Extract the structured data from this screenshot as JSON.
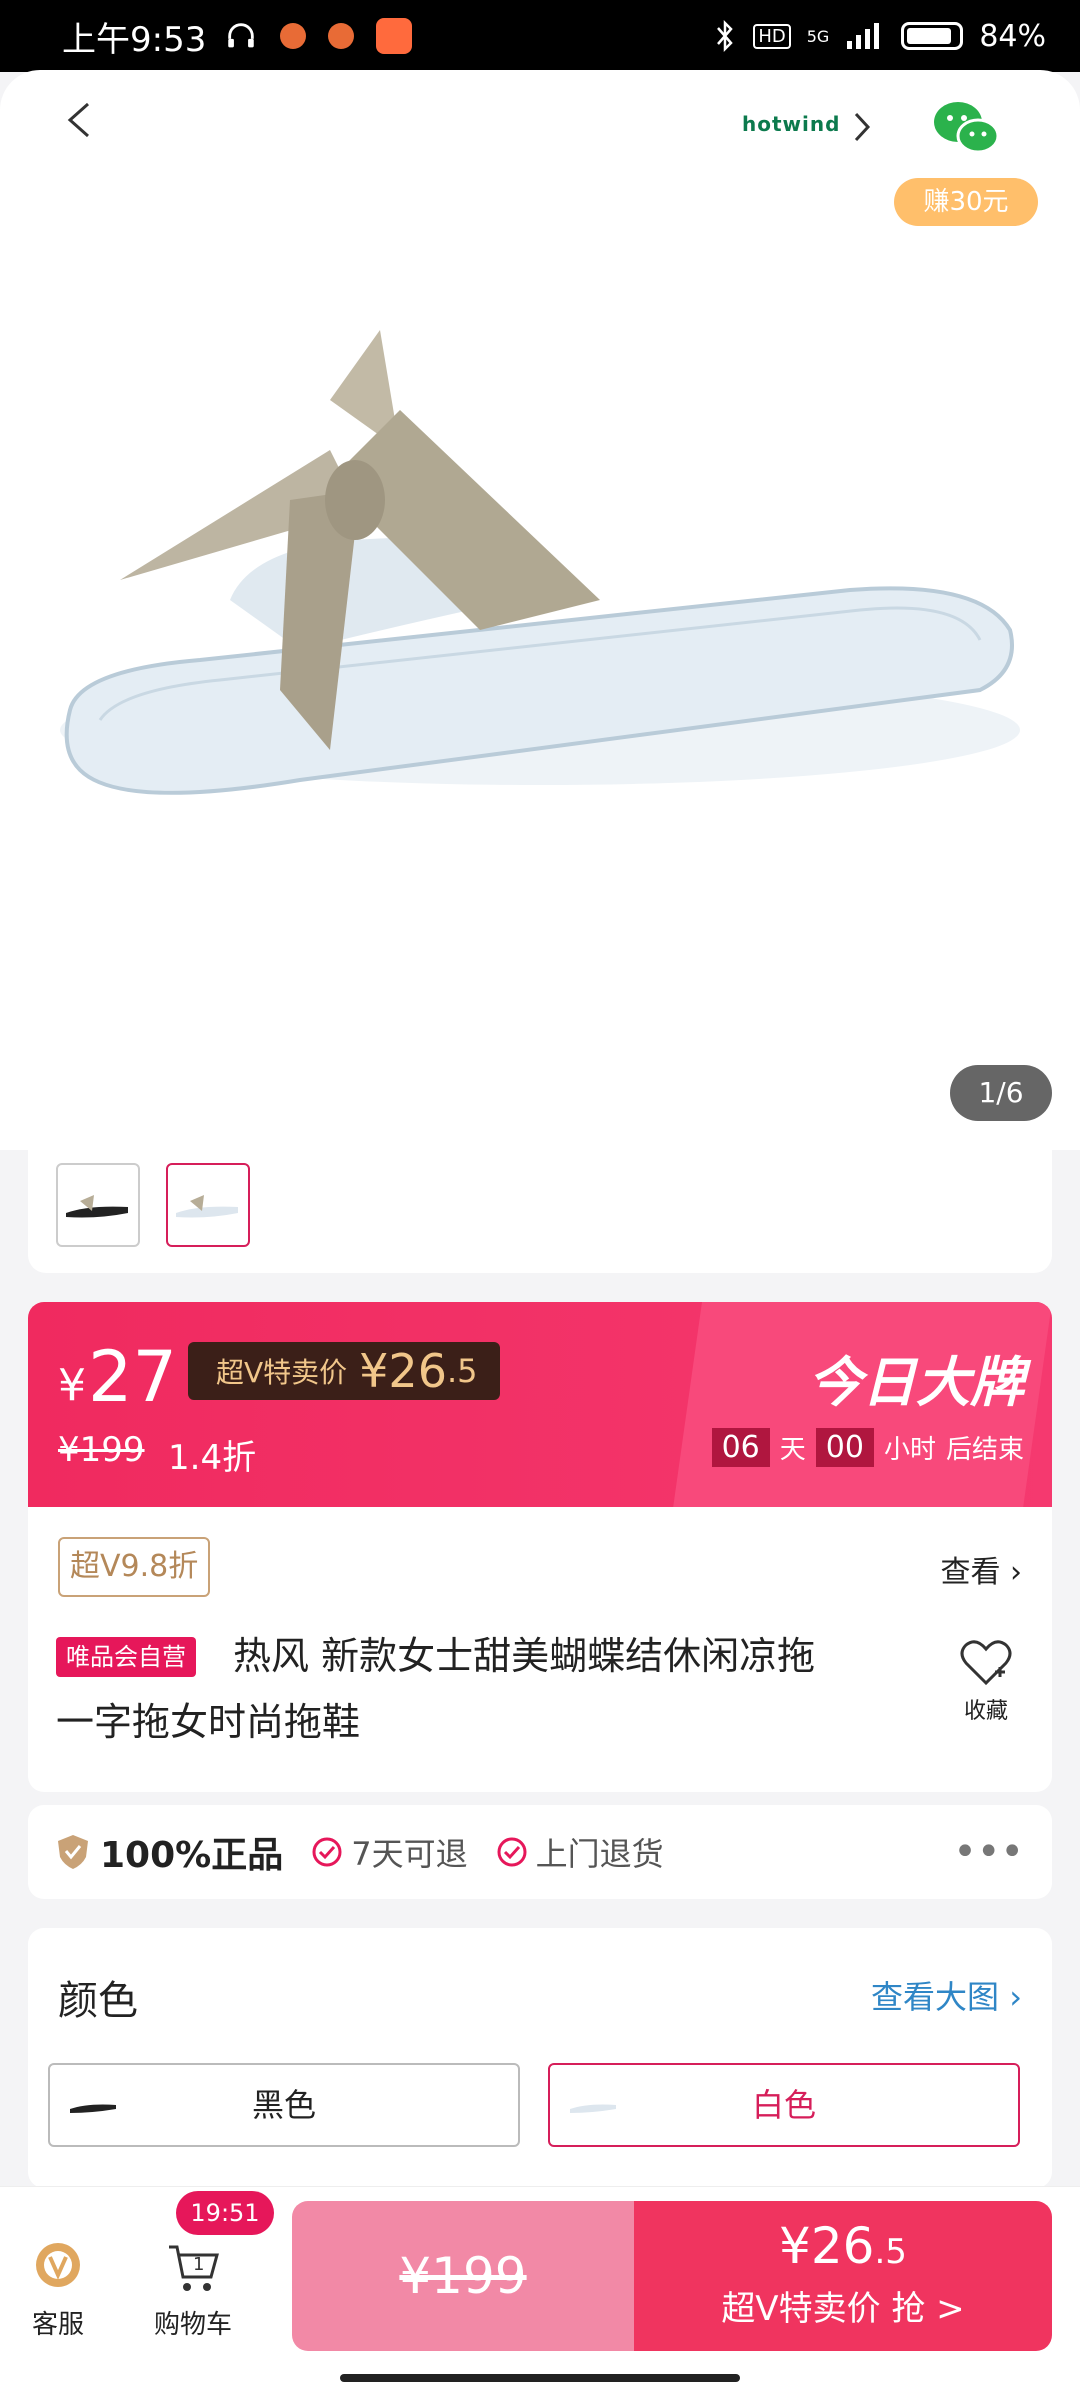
{
  "status_bar": {
    "time": "上午9:53",
    "battery": "84%",
    "network": "5G"
  },
  "header": {
    "brand": "hotwind",
    "earn_badge": "赚30元"
  },
  "gallery": {
    "counter": "1/6"
  },
  "price": {
    "currency": "¥",
    "current": "27",
    "sv_label": "超V特卖价",
    "sv_price_main": "¥26",
    "sv_price_decimal": ".5",
    "original": "¥199",
    "discount": "1.4折",
    "brand_day": "今日大牌",
    "cd_days": "06",
    "cd_day_label": "天",
    "cd_hours": "00",
    "cd_hour_label": "小时",
    "cd_end_label": "后结束"
  },
  "product": {
    "v_tag": "超V9.8折",
    "view_label": "查看",
    "self_op": "唯品会自营",
    "title_line1": "热风 新款女士甜美蝴蝶结休闲凉拖",
    "title_line2": "一字拖女时尚拖鞋",
    "fav_label": "收藏"
  },
  "guarantee": {
    "main": "100%正品",
    "return7": "7天可退",
    "pickup": "上门退货",
    "more": "•••"
  },
  "colors": {
    "title": "颜色",
    "link": "查看大图",
    "options": [
      "黑色",
      "白色"
    ],
    "selected": "白色"
  },
  "bottom_bar": {
    "service_label": "客服",
    "cart_label": "购物车",
    "cart_count": "1",
    "cart_timer": "19:51",
    "orig_price": "¥199",
    "buy_price_main": "¥26",
    "buy_price_decimal": ".5",
    "buy_label": "超V特卖价 抢 >"
  },
  "colors_theme": {
    "accent": "#e6175a",
    "banner": "#f0345f",
    "gold": "#c9a277"
  }
}
